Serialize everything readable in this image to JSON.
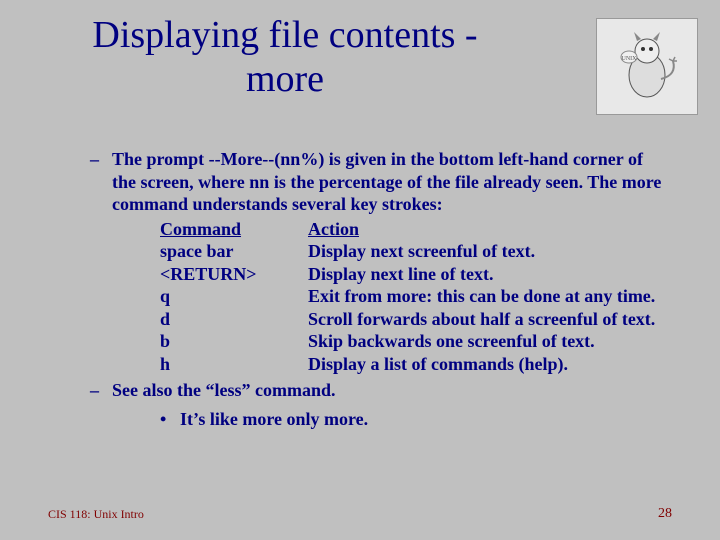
{
  "title_line1": "Displaying file contents -",
  "title_line2": "more",
  "bullet_prompt": "The prompt --More--(nn%) is given in the bottom left-hand corner of the screen, where nn is the percentage of the file already seen.  The more command understands several key strokes:",
  "table": {
    "header_cmd": "Command",
    "header_action": "Action",
    "rows": [
      {
        "cmd": "space bar",
        "action": "Display next screenful of text."
      },
      {
        "cmd": "<RETURN>",
        "action": "Display next line of text."
      },
      {
        "cmd": "q",
        "action": "Exit from more: this can be done at any time."
      },
      {
        "cmd": "d",
        "action": "Scroll forwards about half a screenful of text."
      },
      {
        "cmd": "b",
        "action": "Skip backwards one screenful of text."
      },
      {
        "cmd": "h",
        "action": "Display a list of commands (help)."
      }
    ]
  },
  "see_also": "See also the “less” command.",
  "sub_bullet": "It’s like more only more.",
  "footer_left": "CIS 118: Unix Intro",
  "footer_right": "28",
  "mascot_alt": "cartoon daemon mascot"
}
